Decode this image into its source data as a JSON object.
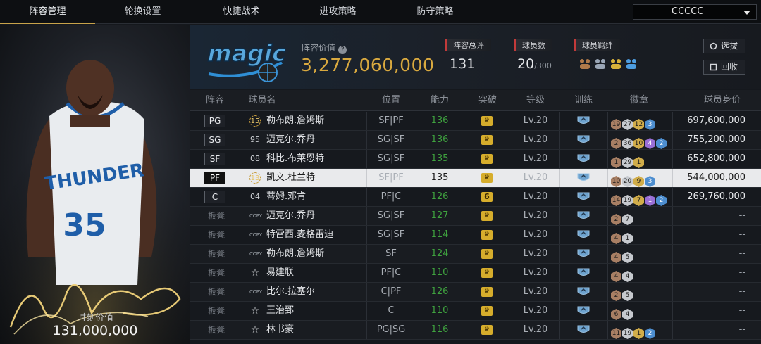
{
  "nav": {
    "tabs": [
      "阵容管理",
      "轮换设置",
      "快捷战术",
      "进攻策略",
      "防守策略"
    ],
    "active_tab": "阵容管理",
    "account_select": "CCCCC"
  },
  "player_card": {
    "moment_label": "时刻价值",
    "moment_value": "131,000,000",
    "jersey_team": "THUNDER",
    "jersey_number": "35"
  },
  "header": {
    "team_logo_text": "magic",
    "lineup_value_label": "阵容价值",
    "lineup_value": "3,277,060,000",
    "overall_label": "阵容总评",
    "overall_value": "131",
    "player_count_label": "球员数",
    "player_count_value": "20",
    "player_count_max": "/300",
    "chemistry_label": "球员羁绊",
    "select_button": "选拔",
    "recycle_button": "回收"
  },
  "table": {
    "columns": [
      "阵容",
      "球员名",
      "位置",
      "能力",
      "突破",
      "等级",
      "训练",
      "徽章",
      "球员身价"
    ],
    "rows": [
      {
        "slot": "PG",
        "num": "15",
        "num_style": "ring",
        "name": "勒布朗.詹姆斯",
        "position": "SF|PF",
        "ability": "136",
        "breakthrough": "",
        "level": "Lv.20",
        "badges": [
          [
            "19",
            "br"
          ],
          [
            "27",
            "sv"
          ],
          [
            "12",
            "gd"
          ],
          [
            "3",
            "bl"
          ]
        ],
        "value": "697,600,000"
      },
      {
        "slot": "SG",
        "num": "95",
        "num_style": "plain",
        "name": "迈克尔.乔丹",
        "position": "SG|SF",
        "ability": "136",
        "breakthrough": "",
        "level": "Lv.20",
        "badges": [
          [
            "2",
            "br"
          ],
          [
            "36",
            "sv"
          ],
          [
            "10",
            "gd"
          ],
          [
            "4",
            "pu"
          ],
          [
            "2",
            "bl"
          ]
        ],
        "value": "755,200,000"
      },
      {
        "slot": "SF",
        "num": "08",
        "num_style": "plain",
        "name": "科比.布莱恩特",
        "position": "SG|SF",
        "ability": "135",
        "breakthrough": "",
        "level": "Lv.20",
        "badges": [
          [
            "1",
            "br"
          ],
          [
            "29",
            "sv"
          ],
          [
            "1",
            "gd"
          ]
        ],
        "value": "652,800,000"
      },
      {
        "slot": "PF",
        "num": "13",
        "num_style": "ring",
        "name": "凯文.杜兰特",
        "position": "SF|PF",
        "ability": "135",
        "breakthrough": "",
        "level": "Lv.20",
        "badges": [
          [
            "10",
            "br"
          ],
          [
            "20",
            "sv"
          ],
          [
            "9",
            "gd"
          ],
          [
            "3",
            "bl"
          ]
        ],
        "value": "544,000,000"
      },
      {
        "slot": "C",
        "num": "04",
        "num_style": "plain",
        "name": "蒂姆.邓肯",
        "position": "PF|C",
        "ability": "126",
        "breakthrough": "6",
        "level": "Lv.20",
        "badges": [
          [
            "14",
            "br"
          ],
          [
            "19",
            "sv"
          ],
          [
            "7",
            "gd"
          ],
          [
            "1",
            "pu"
          ],
          [
            "2",
            "bl"
          ]
        ],
        "value": "269,760,000"
      },
      {
        "slot": "板凳",
        "num": "COPY",
        "num_style": "copy",
        "name": "迈克尔.乔丹",
        "position": "SG|SF",
        "ability": "127",
        "breakthrough": "",
        "level": "Lv.20",
        "badges": [
          [
            "2",
            "br"
          ],
          [
            "7",
            "sv"
          ]
        ],
        "value": "--"
      },
      {
        "slot": "板凳",
        "num": "COPY",
        "num_style": "copy",
        "name": "特雷西.麦格雷迪",
        "position": "SG|SF",
        "ability": "114",
        "breakthrough": "",
        "level": "Lv.20",
        "badges": [
          [
            "4",
            "br"
          ],
          [
            "1",
            "sv"
          ]
        ],
        "value": "--"
      },
      {
        "slot": "板凳",
        "num": "COPY",
        "num_style": "copy",
        "name": "勒布朗.詹姆斯",
        "position": "SF",
        "ability": "124",
        "breakthrough": "",
        "level": "Lv.20",
        "badges": [
          [
            "4",
            "br"
          ],
          [
            "5",
            "sv"
          ]
        ],
        "value": "--"
      },
      {
        "slot": "板凳",
        "num": "☆",
        "num_style": "star",
        "name": "易建联",
        "position": "PF|C",
        "ability": "110",
        "breakthrough": "",
        "level": "Lv.20",
        "badges": [
          [
            "4",
            "br"
          ],
          [
            "4",
            "sv"
          ]
        ],
        "value": "--"
      },
      {
        "slot": "板凳",
        "num": "COPY",
        "num_style": "copy",
        "name": "比尔.拉塞尔",
        "position": "C|PF",
        "ability": "126",
        "breakthrough": "",
        "level": "Lv.20",
        "badges": [
          [
            "2",
            "br"
          ],
          [
            "5",
            "sv"
          ]
        ],
        "value": "--"
      },
      {
        "slot": "板凳",
        "num": "☆",
        "num_style": "star",
        "name": "王治郅",
        "position": "C",
        "ability": "110",
        "breakthrough": "",
        "level": "Lv.20",
        "badges": [
          [
            "6",
            "br"
          ],
          [
            "4",
            "sv"
          ]
        ],
        "value": "--"
      },
      {
        "slot": "板凳",
        "num": "☆",
        "num_style": "star",
        "name": "林书豪",
        "position": "PG|SG",
        "ability": "116",
        "breakthrough": "",
        "level": "Lv.20",
        "badges": [
          [
            "11",
            "br"
          ],
          [
            "19",
            "sv"
          ],
          [
            "1",
            "gd"
          ],
          [
            "2",
            "bl"
          ]
        ],
        "value": "--"
      }
    ],
    "selected_row": 3
  },
  "colors": {
    "gold": "#d9a93f",
    "ability_green": "#3fa33f",
    "accent_red": "#c23a3a",
    "selected_row": "#e9eaec"
  }
}
